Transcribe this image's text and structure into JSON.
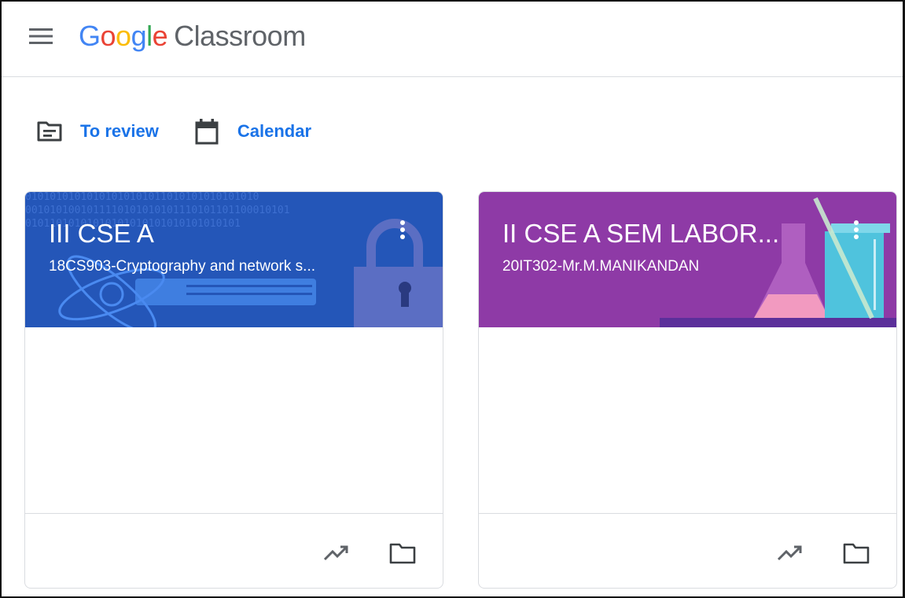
{
  "header": {
    "menu_icon": "hamburger-menu-icon",
    "logo_letters": [
      "G",
      "o",
      "o",
      "g",
      "l",
      "e"
    ],
    "product_name": "Classroom"
  },
  "quick_links": [
    {
      "label": "To review",
      "icon": "to-review-icon"
    },
    {
      "label": "Calendar",
      "icon": "calendar-icon"
    }
  ],
  "classes": [
    {
      "title": "III CSE A",
      "subtitle": "18CS903-Cryptography and network s...",
      "banner_color": "#2456b8",
      "banner_binary": [
        "01010101010101010101011010101010101010",
        "0010101001011110101010101110101101100010101",
        "01011010101010101010101010101010101"
      ],
      "menu_icon": "more-vert-icon",
      "footer_icons": [
        "trending-icon",
        "folder-icon"
      ]
    },
    {
      "title": "II CSE A SEM LABOR...",
      "subtitle": "20IT302-Mr.M.MANIKANDAN",
      "banner_color": "#8e3aa6",
      "menu_icon": "more-vert-icon",
      "footer_icons": [
        "trending-icon",
        "folder-icon"
      ]
    }
  ],
  "colors": {
    "accent": "#1a73e8",
    "divider": "#dadce0"
  }
}
